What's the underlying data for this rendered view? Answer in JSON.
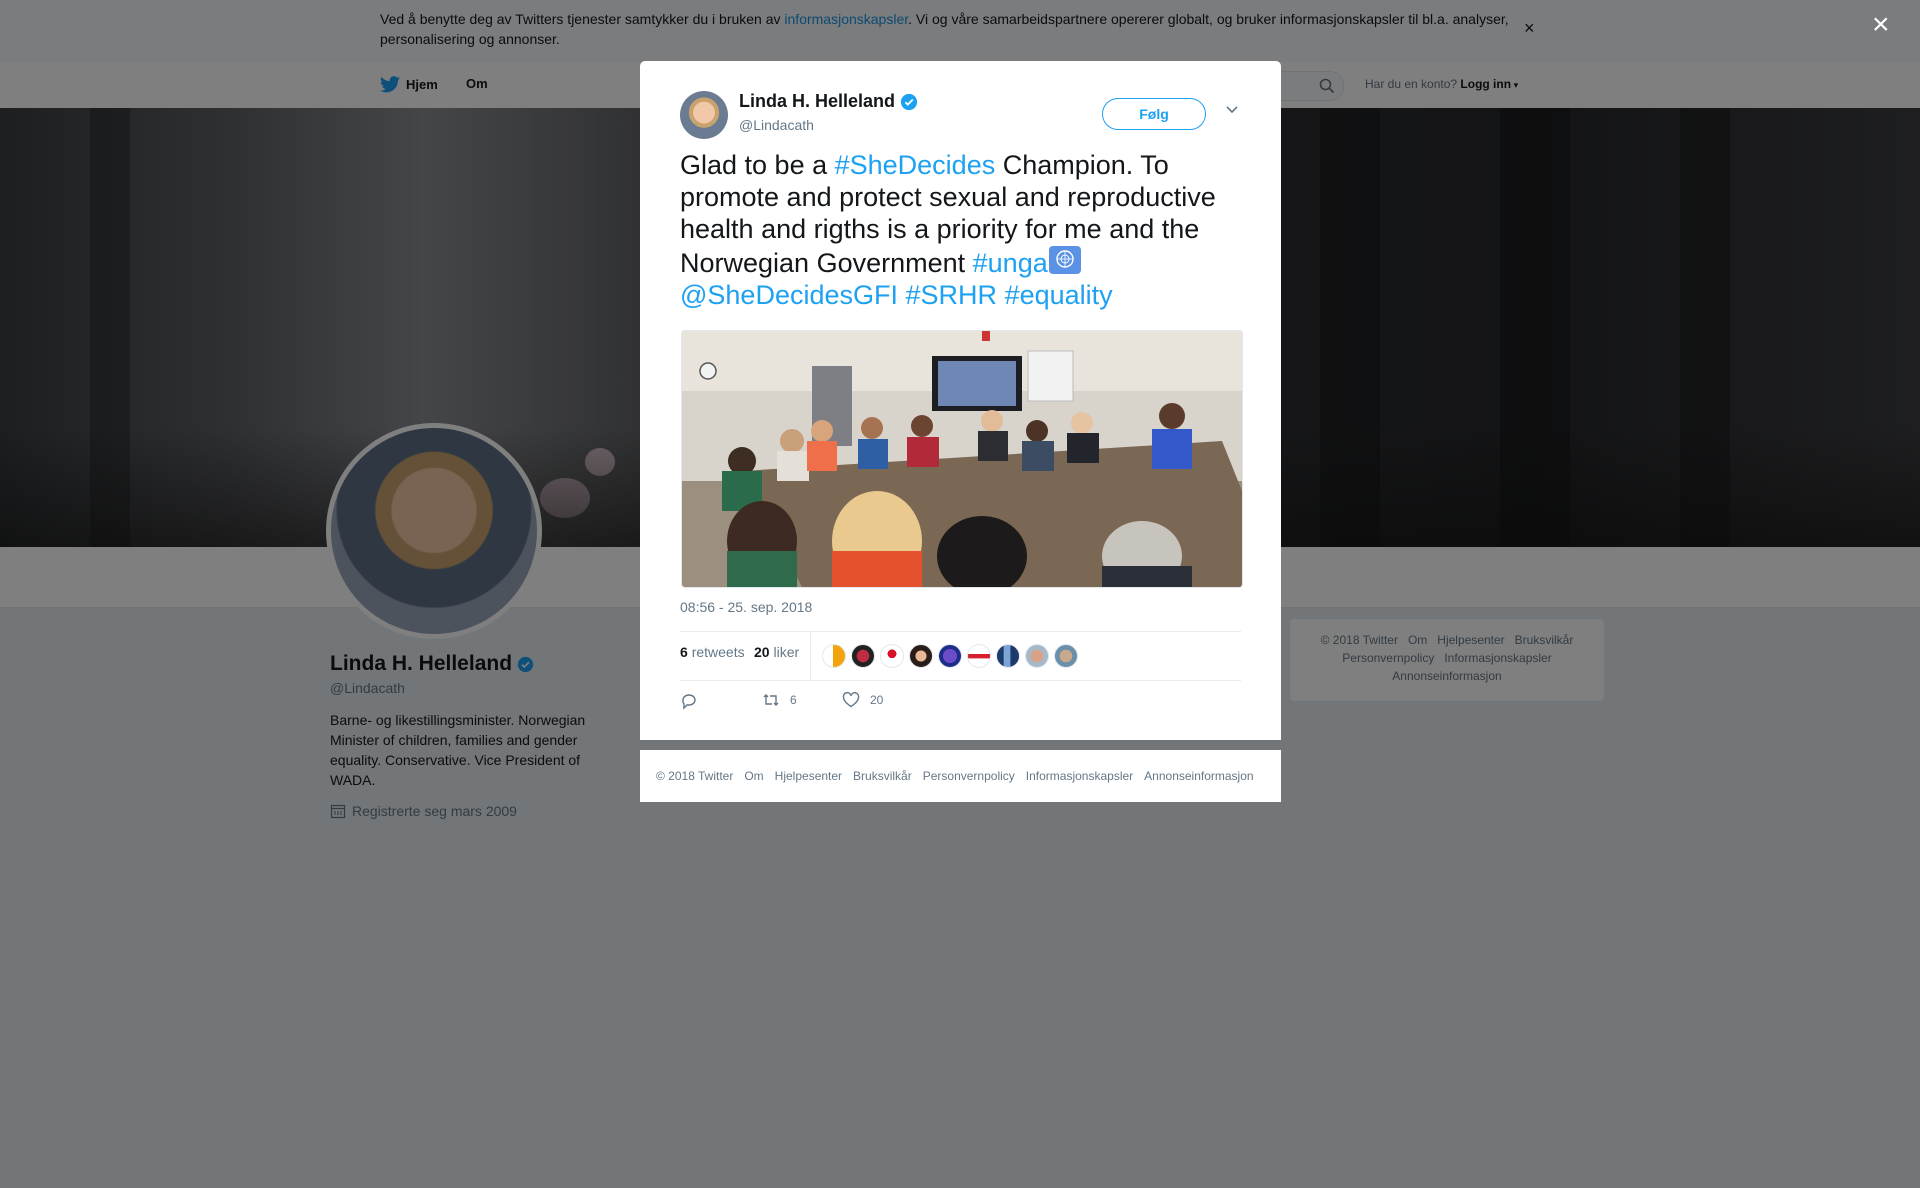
{
  "cookie": {
    "text_before": "Ved å benytte deg av Twitters tjenester samtykker du i bruken av ",
    "link": "informasjonskapsler",
    "text_after": ". Vi og våre samarbeidspartnere opererer globalt, og bruker informasjonskapsler til bl.a. analyser, personalisering og annonser.",
    "close": "×"
  },
  "nav": {
    "home": "Hjem",
    "about": "Om",
    "account_prompt": "Har du en konto?",
    "login": "Logg inn"
  },
  "profile": {
    "name": "Linda H. Helleland",
    "handle": "@Lindacath",
    "bio": "Barne- og likestillingsminister. Norwegian Minister of children, families and gender equality. Conservative. Vice President of WADA.",
    "joined": "Registrerte seg mars 2009"
  },
  "side_footer": {
    "links": [
      "© 2018 Twitter",
      "Om",
      "Hjelpesenter",
      "Bruksvilkår",
      "Personvernpolicy",
      "Informasjonskapsler",
      "Annonseinformasjon"
    ]
  },
  "overlay": {
    "close": "×"
  },
  "tweet": {
    "name": "Linda H. Helleland",
    "handle": "@Lindacath",
    "follow": "Følg",
    "text": {
      "p1": "Glad to be a ",
      "tag1": "#SheDecides",
      "p2": " Champion. To promote and protect sexual and reproductive health and rigths is a priority for me and the Norwegian Government ",
      "tag2": "#unga",
      "tag3": "@SheDecidesGFI",
      "tag4": "#SRHR",
      "tag5": "#equality"
    },
    "time": "08:56 - 25. sep. 2018",
    "retweets_count": "6",
    "retweets_label": "retweets",
    "likes_count": "20",
    "likes_label": "liker",
    "action_retweets": "6",
    "action_likes": "20"
  },
  "modal_footer": {
    "links": [
      "© 2018 Twitter",
      "Om",
      "Hjelpesenter",
      "Bruksvilkår",
      "Personvernpolicy",
      "Informasjonskapsler",
      "Annonseinformasjon"
    ]
  },
  "colors": {
    "twitter_blue": "#1da1f2",
    "verified": "#1da1f2",
    "text": "#14171a",
    "muted": "#657786"
  }
}
